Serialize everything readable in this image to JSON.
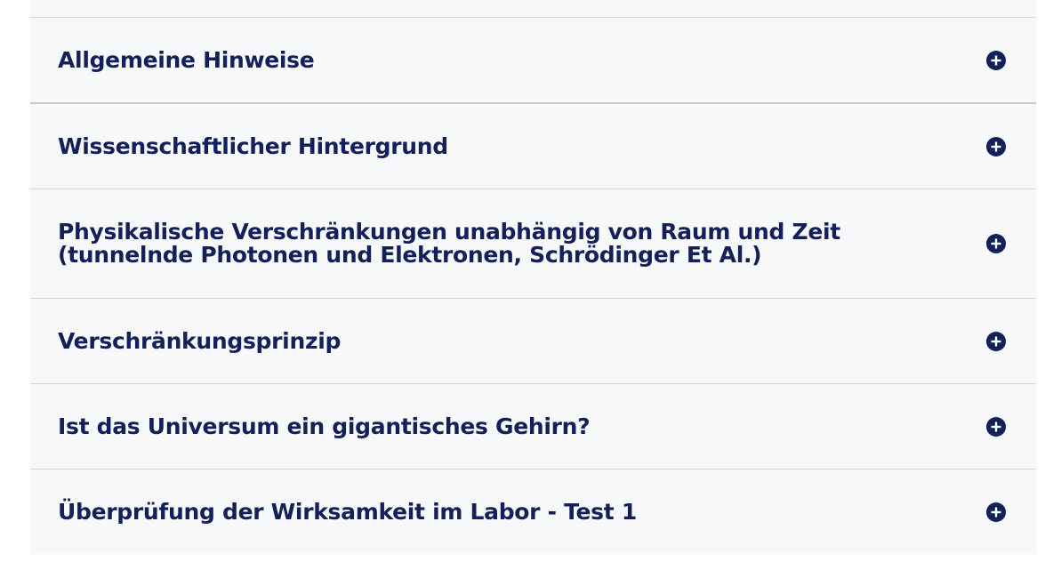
{
  "accordion": {
    "items": [
      {
        "title": "Allgemeine Hinweise",
        "icon": "plus-circle-icon"
      },
      {
        "title": "Wissenschaftlicher Hintergrund",
        "icon": "plus-circle-icon"
      },
      {
        "title": "Physikalische Verschränkungen unabhängig von Raum und Zeit (tunnelnde Photonen und Elektronen, Schrödinger Et Al.)",
        "icon": "plus-circle-icon"
      },
      {
        "title": "Verschränkungsprinzip",
        "icon": "plus-circle-icon"
      },
      {
        "title": "Ist das Universum ein gigantisches Gehirn?",
        "icon": "plus-circle-icon"
      },
      {
        "title": "Überprüfung der Wirksamkeit im Labor - Test 1",
        "icon": "plus-circle-icon"
      }
    ]
  },
  "colors": {
    "title": "#13205a",
    "icon": "#13205a",
    "panel_bg": "#f7f8fa",
    "divider": "#d4d6db"
  }
}
